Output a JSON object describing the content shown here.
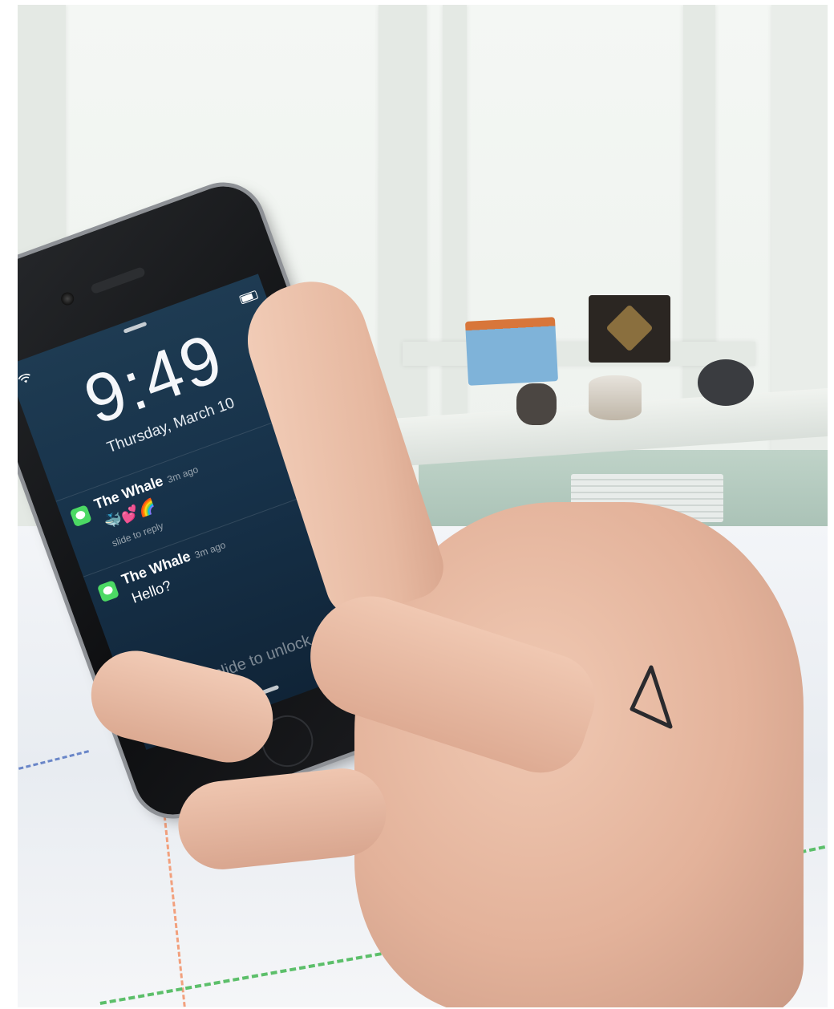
{
  "lock_screen": {
    "time": "9:49",
    "date": "Thursday, March 10",
    "slide_to_unlock": "slide to unlock",
    "notifications": [
      {
        "app_icon": "messages-icon",
        "sender": "The Whale",
        "ago": "3m ago",
        "body": "🐳💕🌈",
        "action_hint": "slide to reply"
      },
      {
        "app_icon": "messages-icon",
        "sender": "The Whale",
        "ago": "3m ago",
        "body": "Hello?",
        "action_hint": ""
      }
    ]
  },
  "colors": {
    "screen_bg": "#17324a",
    "messages_green": "#4cd964",
    "skin": "#e3b29a",
    "wall_green": "#a9c4b7"
  },
  "icons": [
    "wifi-icon",
    "battery-icon",
    "messages-icon",
    "camera-icon",
    "triangle-tattoo-icon"
  ]
}
